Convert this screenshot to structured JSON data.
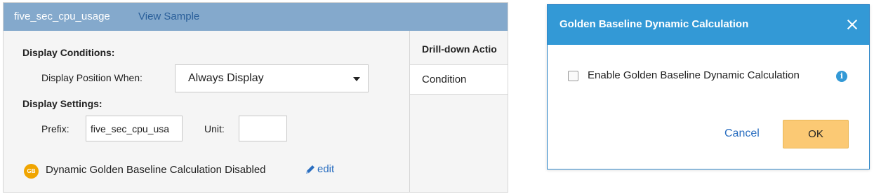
{
  "panel": {
    "metric_name": "five_sec_cpu_usage",
    "view_sample_link": "View Sample",
    "display_conditions_label": "Display Conditions:",
    "display_position_label": "Display Position When:",
    "display_position_value": "Always Display",
    "display_settings_label": "Display Settings:",
    "prefix_label": "Prefix:",
    "prefix_value": "five_sec_cpu_usa",
    "unit_label": "Unit:",
    "unit_value": "",
    "gb_badge": "GB",
    "gb_status": "Dynamic Golden Baseline Calculation Disabled",
    "edit_link": "edit",
    "drill_down_header": "Drill-down Actio",
    "drill_down_column": "Condition"
  },
  "modal": {
    "title": "Golden Baseline Dynamic Calculation",
    "checkbox_label": "Enable Golden Baseline Dynamic Calculation",
    "checkbox_checked": false,
    "info_icon": "i",
    "cancel_label": "Cancel",
    "ok_label": "OK"
  },
  "colors": {
    "panel_header": "#84a9cc",
    "modal_header": "#3399d6",
    "badge": "#f0a500",
    "ok_button": "#fbc974",
    "link": "#2a6ec0"
  }
}
